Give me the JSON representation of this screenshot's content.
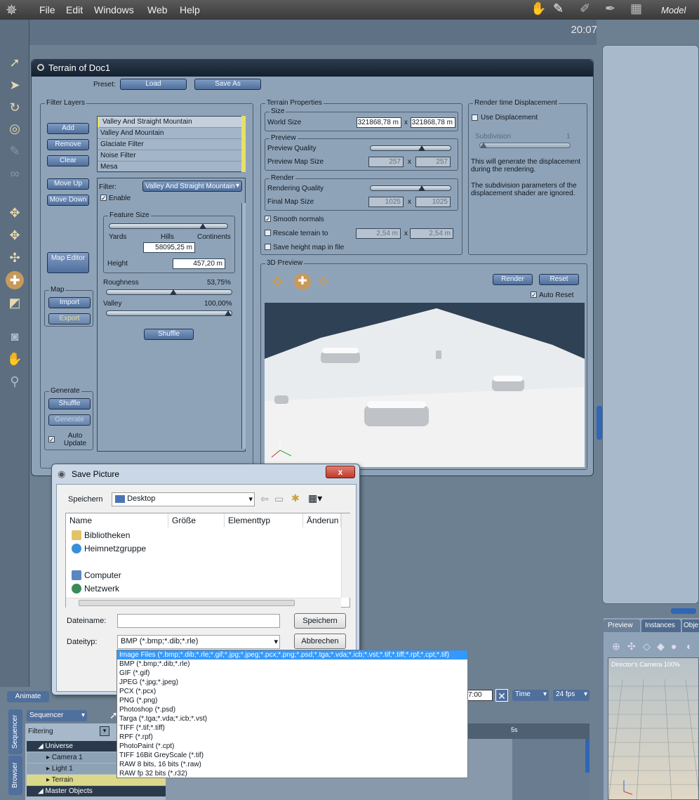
{
  "menubar": {
    "items": [
      "File",
      "Edit",
      "Windows",
      "Web",
      "Help"
    ],
    "mode": "Model",
    "time": "20:07"
  },
  "terrain_window": {
    "title": "Terrain of Doc1",
    "preset_label": "Preset:",
    "load_label": "Load",
    "save_as_label": "Save As",
    "filter_layers": {
      "title": "Filter Layers",
      "add": "Add",
      "remove": "Remove",
      "clear": "Clear",
      "move_up": "Move Up",
      "move_down": "Move Down",
      "map_editor": "Map Editor",
      "layers": [
        "Valley And Straight Mountain",
        "Valley And Mountain",
        "Glaciate Filter",
        "Noise Filter",
        "Mesa"
      ],
      "filter_label": "Filter:",
      "filter_value": "Valley And Straight Mountain",
      "enable_label": "Enable",
      "feature_size": "Feature Size",
      "yards": "Yards",
      "hills": "Hills",
      "continents": "Continents",
      "feature_size_value": "58095,25 m",
      "height_label": "Height",
      "height_value": "457,20 m",
      "roughness_label": "Roughness",
      "roughness_value": "53,75%",
      "roughness_level": 0.5375,
      "valley_label": "Valley",
      "valley_value": "100,00%",
      "valley_level": 1.0,
      "shuffle": "Shuffle"
    },
    "map": {
      "title": "Map",
      "import": "Import",
      "export": "Export"
    },
    "generate": {
      "title": "Generate",
      "shuffle": "Shuffle",
      "generate": "Generate",
      "auto_update": "Auto Update"
    },
    "terrain_properties": {
      "title": "Terrain Properties",
      "size": "Size",
      "world_size_label": "World Size",
      "world_size_x": "321868,78 m",
      "world_size_y": "321868,78 m",
      "preview": "Preview",
      "preview_quality": "Preview Quality",
      "preview_map_size": "Preview Map Size",
      "preview_map_x": "257",
      "preview_map_y": "257",
      "render": "Render",
      "rendering_quality": "Rendering Quality",
      "final_map_size": "Final Map Size",
      "final_map_x": "1025",
      "final_map_y": "1025",
      "times": "x",
      "smooth_normals": "Smooth normals",
      "rescale_label": "Rescale terrain to",
      "rescale_x": "2,54 m",
      "rescale_y": "2,54 m",
      "save_height_map": "Save height map in file"
    },
    "displacement": {
      "title": "Render time Displacement",
      "use_displacement": "Use Displacement",
      "subdivision": "Subdivision",
      "subdivision_value": "1",
      "text1": "This will generate the displacement during the rendering.",
      "text2": "The subdivision parameters of the displacement shader are ignored."
    },
    "preview3d": {
      "title": "3D Preview",
      "render": "Render",
      "reset": "Reset",
      "auto_reset": "Auto Reset"
    }
  },
  "save_dialog": {
    "title": "Save Picture",
    "speichern_label": "Speichern",
    "location": "Desktop",
    "columns": [
      "Name",
      "Größe",
      "Elementtyp",
      "Änderun"
    ],
    "items": [
      "Bibliotheken",
      "Heimnetzgruppe",
      "Computer",
      "Netzwerk"
    ],
    "dateiname_label": "Dateiname:",
    "dateiname_value": "",
    "dateityp_label": "Dateityp:",
    "dateityp_value": "BMP (*.bmp;*.dib;*.rle)",
    "save_button": "Speichern",
    "cancel_button": "Abbrechen",
    "close": "x",
    "filetypes": [
      "Image Files (*.bmp;*.dib;*.rle;*.gif;*.jpg;*.jpeg;*.pcx;*.png;*.psd;*.tga;*.vda;*.icb;*.vst;*.tif;*.tiff;*.rpf;*.cpt;*.tif)",
      "BMP (*.bmp;*.dib;*.rle)",
      "GIF (*.gif)",
      "JPEG (*.jpg;*.jpeg)",
      "PCX (*.pcx)",
      "PNG (*.png)",
      "Photoshop (*.psd)",
      "Targa (*.tga;*.vda;*.icb;*.vst)",
      "TIFF (*.tif;*.tiff)",
      "RPF (*.rpf)",
      "PhotoPaint (*.cpt)",
      "TIFF 16Bit GreyScale (*.tif)",
      "RAW 8 bits, 16 bits (*.raw)",
      "RAW fp 32 bits (*.r32)"
    ]
  },
  "right_panel": {
    "tabs": [
      "Preview",
      "Instances",
      "Obje"
    ],
    "camera_label": "Director's Camera 100%"
  },
  "bottom": {
    "animate": "Animate",
    "time_value": "7:00",
    "time_label": "Time",
    "fps_label": "24 fps",
    "sequencer": "Sequencer",
    "filtering": "Filtering",
    "side_tabs": [
      "Sequencer",
      "Browser"
    ],
    "tree": [
      "Universe",
      "Camera 1",
      "Light 1",
      "Terrain",
      "Master Objects"
    ],
    "marker": "5s"
  }
}
